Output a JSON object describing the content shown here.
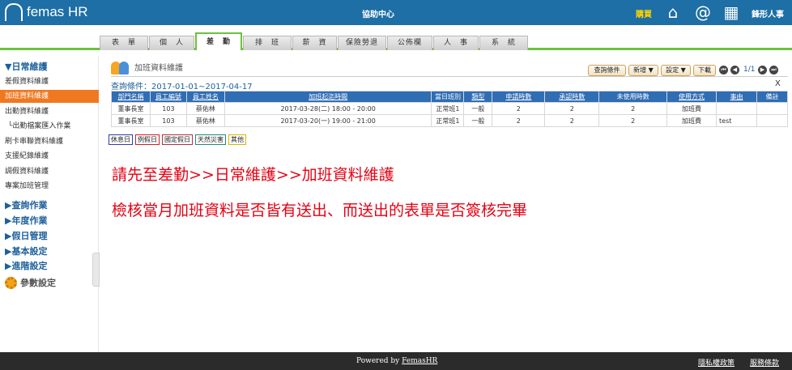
{
  "header": {
    "brand": "femas HR",
    "help_center": "協助中心",
    "purchase": "購買",
    "user_name": "鋒形人事",
    "icons": [
      "home-icon",
      "at-icon",
      "calendar-icon"
    ]
  },
  "tabs": [
    "表　單",
    "個　人",
    "差　勤",
    "排　班",
    "薪　資",
    "保險勞退",
    "公佈欄",
    "人　事",
    "系　統"
  ],
  "sidebar": {
    "daily_heading": "▼日常維護",
    "items": [
      "差假資料維護",
      "加班資料維護",
      "出勤資料維護",
      "└出勤檔案匯入作業",
      "刷卡串聯資料維護",
      "支援紀錄維護",
      "調假資料維護",
      "專案加班管理"
    ],
    "sections": [
      "▶查詢作業",
      "▶年度作業",
      "▶假日管理",
      "▶基本設定",
      "▶進階設定"
    ],
    "params": "參數設定"
  },
  "page": {
    "title": "加班資料維護",
    "query_criteria": "查詢條件：2017-01-01~2017-04-17",
    "close": "X"
  },
  "toolbar": {
    "query_btn": "查詢條件",
    "add_btn": "新增 ▼",
    "settings_btn": "設定 ▼",
    "download_btn": "下載",
    "page_indicator": "1/1"
  },
  "table": {
    "headers": [
      "部門名稱",
      "員工編號",
      "員工姓名",
      "加班起迄時間",
      "當日班別",
      "類型",
      "申請時數",
      "承認時數",
      "未使用時數",
      "使用方式",
      "事由",
      "備註"
    ],
    "rows": [
      [
        "董事長室",
        "103",
        "蔡佑林",
        "2017-03-28(二) 18:00 - 20:00",
        "正常班1",
        "一般",
        "2",
        "2",
        "2",
        "加班費",
        "",
        ""
      ],
      [
        "董事長室",
        "103",
        "蔡佑林",
        "2017-03-20(一) 19:00 - 21:00",
        "正常班1",
        "一般",
        "2",
        "2",
        "2",
        "加班費",
        "test",
        ""
      ]
    ]
  },
  "legend": [
    {
      "label": "休息日",
      "color": "#2a3fa8"
    },
    {
      "label": "例假日",
      "color": "#d02020"
    },
    {
      "label": "國定假日",
      "color": "#b0323c"
    },
    {
      "label": "天然災害",
      "color": "#1e8a7a"
    },
    {
      "label": "其他",
      "color": "#d8b400"
    }
  ],
  "notes": {
    "line1": "請先至差勤>>日常維護>>加班資料維護",
    "line2": "檢核當月加班資料是否皆有送出、而送出的表單是否簽核完畢"
  },
  "footer": {
    "powered_prefix": "Powered by ",
    "powered_link": "FemasHR",
    "privacy": "隱私權政策",
    "terms": "服務條款"
  },
  "colors": {
    "header_bg": "#1d6fa5",
    "active_menu": "#f07820",
    "tab_accent": "#6dc13b",
    "table_header": "#2f6db5",
    "note_red": "#e60012"
  }
}
